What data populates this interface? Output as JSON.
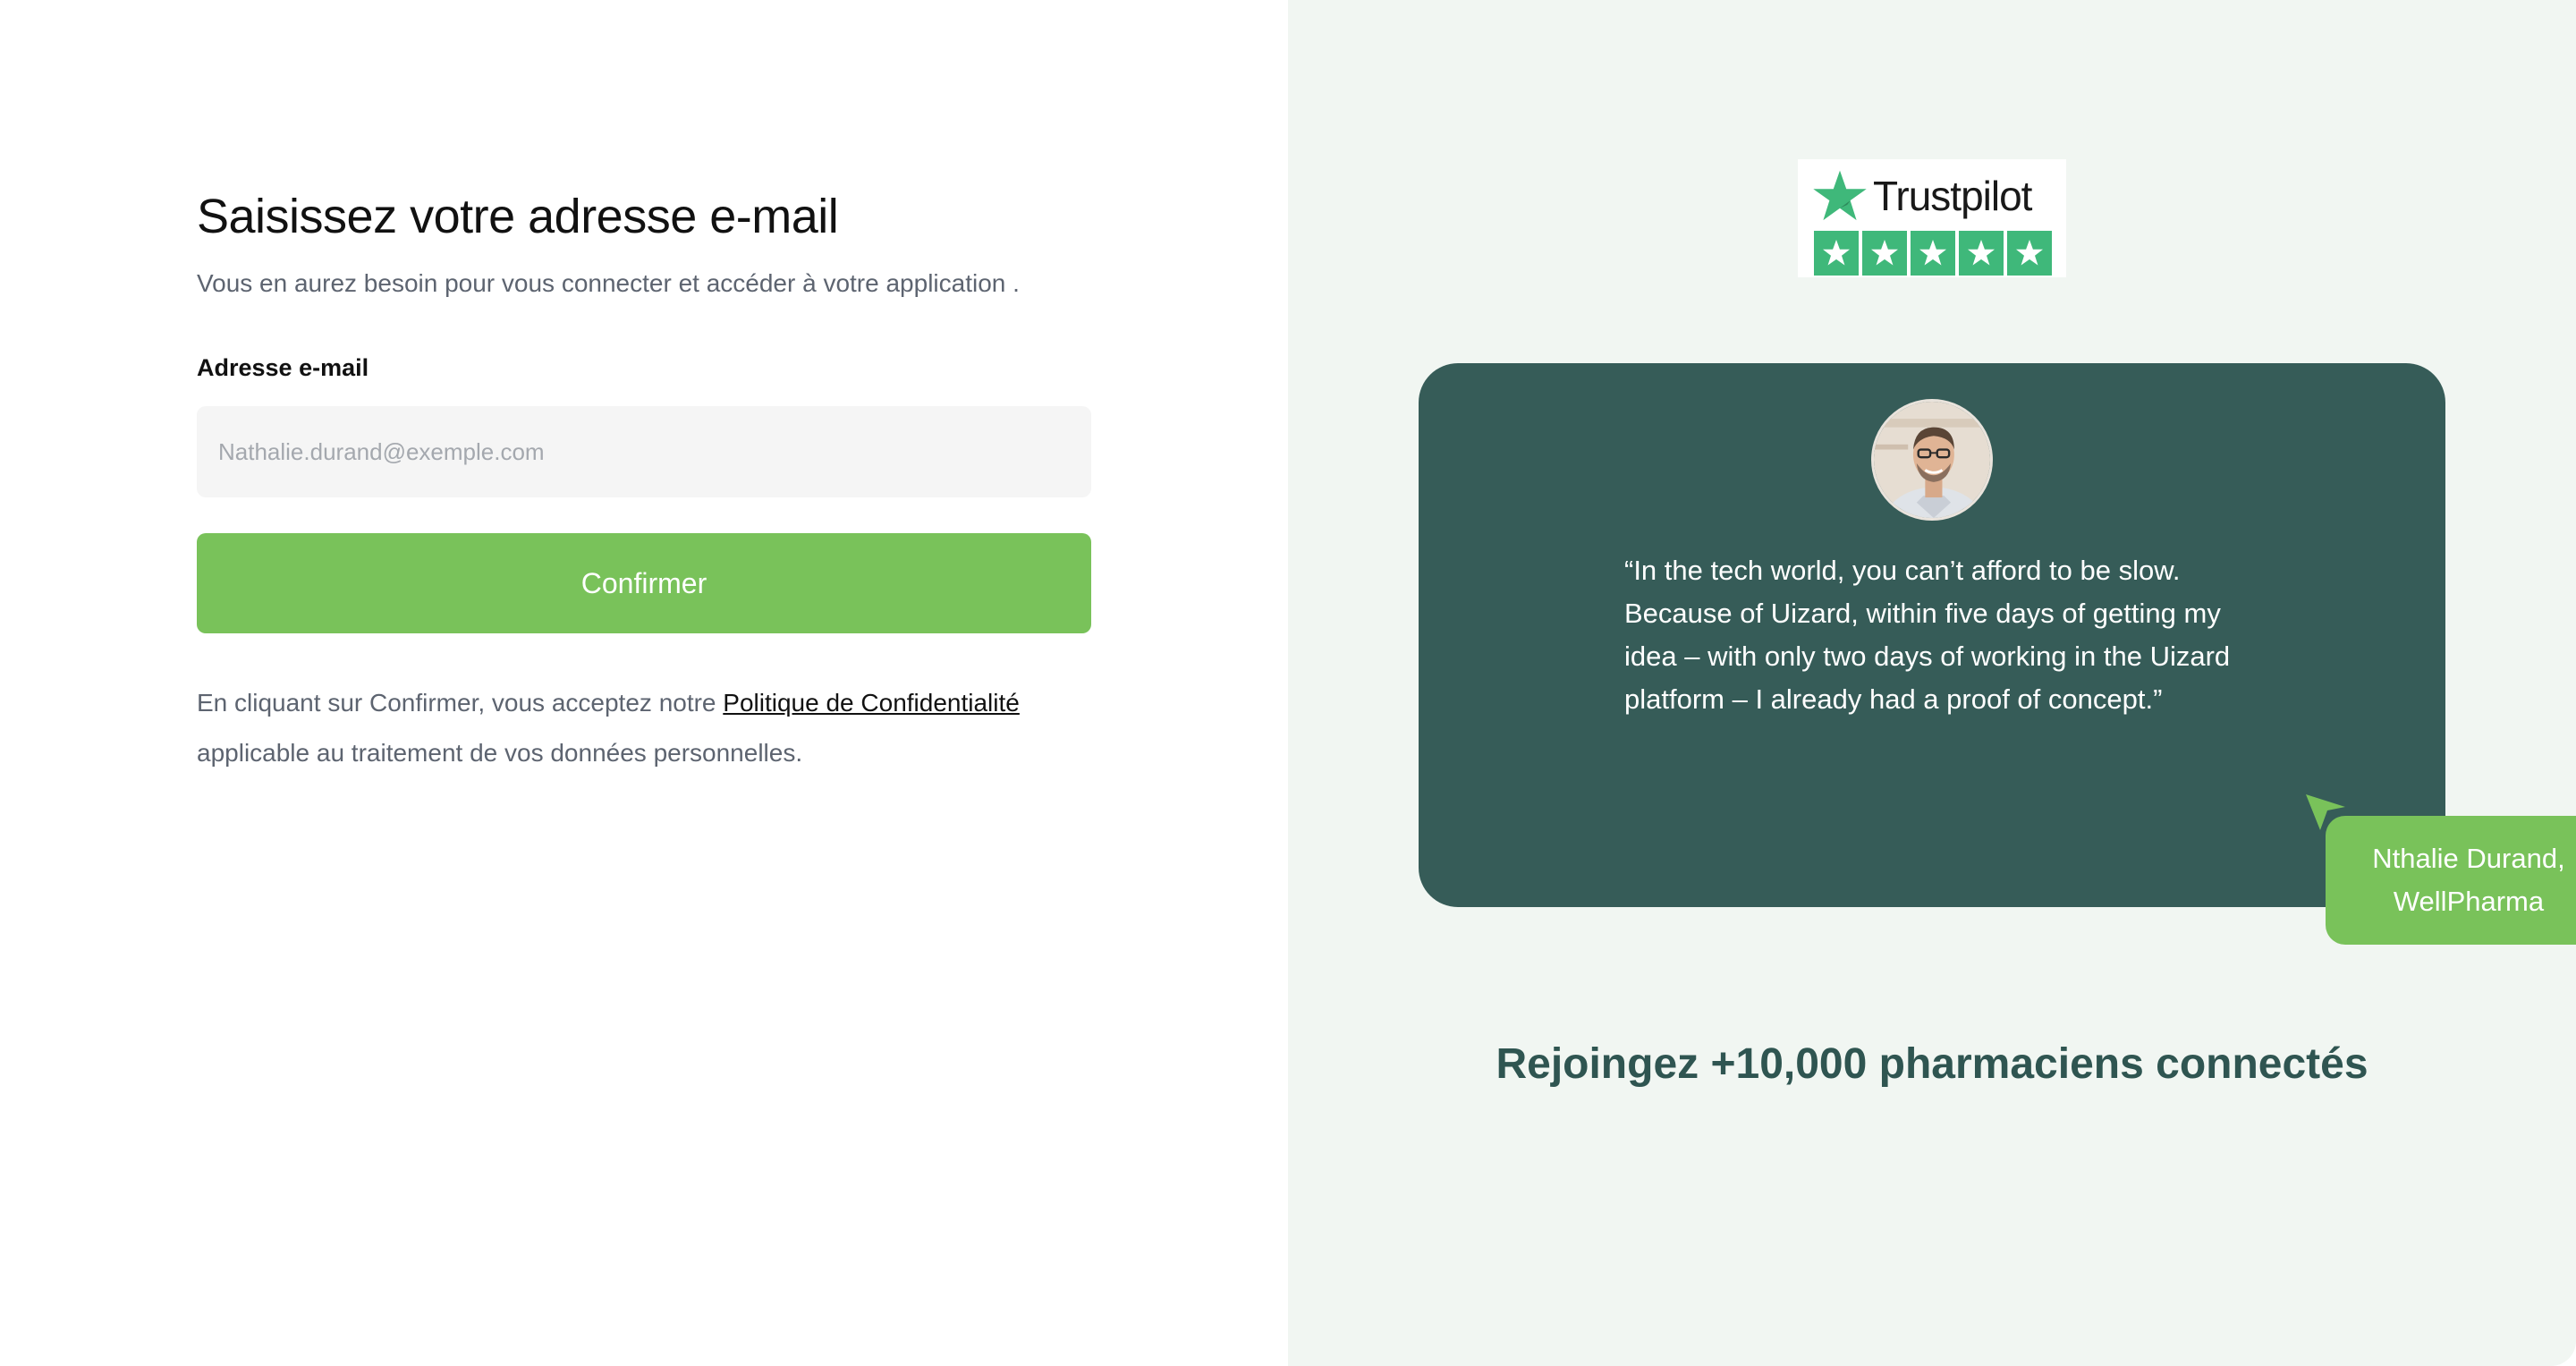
{
  "form": {
    "title": "Saisissez votre adresse e-mail",
    "subtitle": "Vous en aurez besoin pour vous connecter et accéder à votre application .",
    "email_label": "Adresse e-mail",
    "email_placeholder": "Nathalie.durand@exemple.com",
    "email_value": "",
    "confirm_label": "Confirmer",
    "legal_prefix": "En cliquant sur Confirmer, vous acceptez notre ",
    "legal_link": "Politique de Confidentialité",
    "legal_suffix": "applicable au traitement de vos données personnelles."
  },
  "trustpilot": {
    "brand": "Trustpilot",
    "stars": 5
  },
  "testimonial": {
    "quote": "“In the tech world, you can’t afford to be slow. Because of Uizard, within five days of getting my idea – with only two days of working in the Uizard platform – I already had a proof of concept.”",
    "author_name": "Nthalie Durand,",
    "author_company": "WellPharma"
  },
  "join_text": "Rejoingez +10,000 pharmaciens connectés",
  "colors": {
    "accent_green": "#79c25a",
    "card_dark_green": "#365c58",
    "right_bg": "#f1f6f2",
    "trustpilot_green": "#3fb87a"
  }
}
